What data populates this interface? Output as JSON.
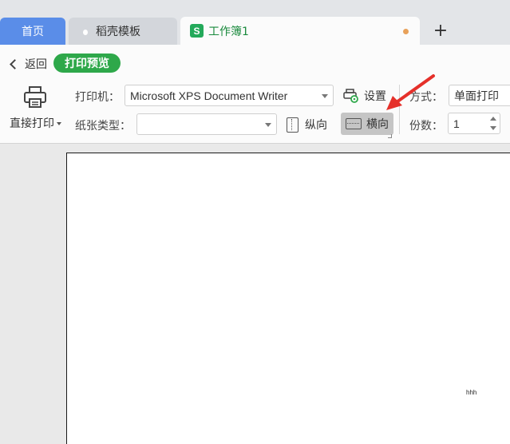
{
  "tabs": {
    "home": "首页",
    "templates": "稻壳模板",
    "workbook": "工作簿1",
    "workbook_icon_letter": "S",
    "new_tab": "+"
  },
  "toolbar": {
    "back_label": "返回",
    "print_preview_label": "打印预览",
    "direct_print_label": "直接打印",
    "printer_label": "打印机：",
    "printer_value": "Microsoft XPS Document Writer",
    "paper_type_label": "纸张类型：",
    "paper_type_value": "",
    "settings_label": "设置",
    "portrait_label": "纵向",
    "landscape_label": "横向",
    "mode_label": "方式：",
    "mode_value": "单面打印",
    "copies_label": "份数：",
    "copies_value": "1"
  },
  "preview": {
    "cell_text": "hhh"
  },
  "colors": {
    "tab_home_bg": "#5a8de8",
    "badge_green": "#2ea84a",
    "workbook_green": "#23a95a",
    "annotation_red": "#e5302a"
  },
  "icons": {
    "back": "chevron-left-icon",
    "printer": "printer-icon",
    "settings": "printer-settings-icon",
    "portrait": "portrait-page-icon",
    "landscape": "landscape-page-icon",
    "templates": "docer-flame-icon",
    "workbook": "spreadsheet-s-icon",
    "unsaved": "unsaved-dot-icon"
  }
}
